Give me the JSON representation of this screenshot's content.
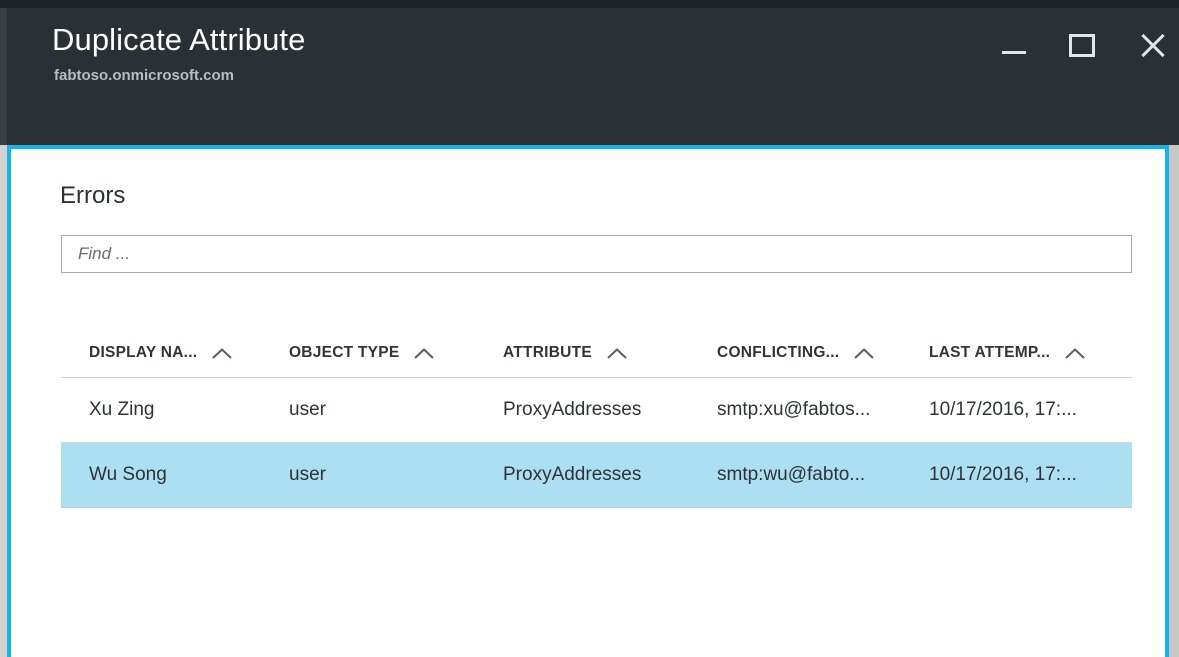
{
  "window": {
    "title": "Duplicate Attribute",
    "subtitle": "fabtoso.onmicrosoft.com",
    "controls": {
      "minimize": "Minimize",
      "maximize": "Maximize",
      "close": "Close"
    },
    "accent_color": "#13b5ea",
    "titlebar_color": "#2b3034",
    "selection_color": "#addff2"
  },
  "content": {
    "section_title": "Errors",
    "search": {
      "value": "",
      "placeholder": "Find ..."
    },
    "table": {
      "columns": [
        {
          "label": "DISPLAY NA...",
          "sort_icon": "chevron-up-icon"
        },
        {
          "label": "OBJECT TYPE",
          "sort_icon": "chevron-up-icon"
        },
        {
          "label": "ATTRIBUTE",
          "sort_icon": "chevron-up-icon"
        },
        {
          "label": "CONFLICTING...",
          "sort_icon": "chevron-up-icon"
        },
        {
          "label": "LAST ATTEMP...",
          "sort_icon": "chevron-up-icon"
        }
      ],
      "rows": [
        {
          "display_name": "Xu Zing",
          "object_type": "user",
          "attribute": "ProxyAddresses",
          "conflicting_value": "smtp:xu@fabtos...",
          "last_attempt": "10/17/2016, 17:...",
          "selected": false
        },
        {
          "display_name": "Wu Song",
          "object_type": "user",
          "attribute": "ProxyAddresses",
          "conflicting_value": "smtp:wu@fabto...",
          "last_attempt": "10/17/2016, 17:...",
          "selected": true
        }
      ]
    }
  }
}
